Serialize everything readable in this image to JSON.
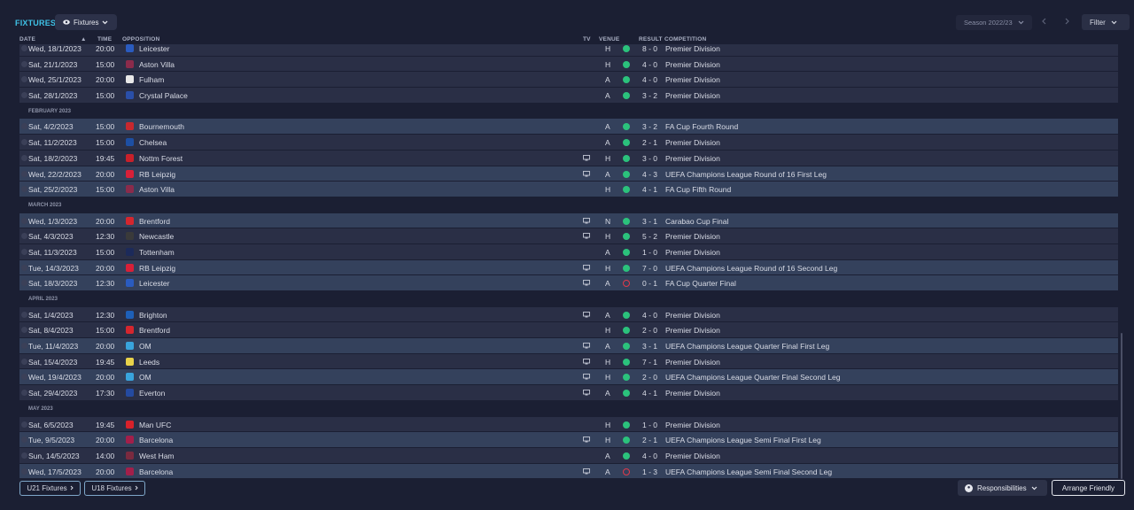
{
  "header": {
    "title": "FIXTURES",
    "view_label": "Fixtures",
    "season_label": "Season 2022/23",
    "filter_label": "Filter"
  },
  "columns": {
    "date": "DATE",
    "time": "TIME",
    "opposition": "OPPOSITION",
    "tv": "TV",
    "venue": "VENUE",
    "result": "RESULT",
    "competition": "COMPETITION"
  },
  "sections": [
    {
      "month": "",
      "rows": [
        {
          "date": "Wed, 18/1/2023",
          "time": "20:00",
          "opp": "Leicester",
          "crest": "#2a5bbf",
          "tv": false,
          "venue": "H",
          "outcome": "win",
          "result": "8 - 0",
          "comp": "Premier Division",
          "hl": false
        },
        {
          "date": "Sat, 21/1/2023",
          "time": "15:00",
          "opp": "Aston Villa",
          "crest": "#8b2b4b",
          "tv": false,
          "venue": "H",
          "outcome": "win",
          "result": "4 - 0",
          "comp": "Premier Division",
          "hl": false
        },
        {
          "date": "Wed, 25/1/2023",
          "time": "20:00",
          "opp": "Fulham",
          "crest": "#e8e8e8",
          "tv": false,
          "venue": "A",
          "outcome": "win",
          "result": "4 - 0",
          "comp": "Premier Division",
          "hl": false
        },
        {
          "date": "Sat, 28/1/2023",
          "time": "15:00",
          "opp": "Crystal Palace",
          "crest": "#2a4fa8",
          "tv": false,
          "venue": "A",
          "outcome": "win",
          "result": "3 - 2",
          "comp": "Premier Division",
          "hl": false
        }
      ]
    },
    {
      "month": "FEBRUARY 2023",
      "rows": [
        {
          "date": "Sat, 4/2/2023",
          "time": "15:00",
          "opp": "Bournemouth",
          "crest": "#c8282e",
          "tv": false,
          "venue": "A",
          "outcome": "win",
          "result": "3 - 2",
          "comp": "FA Cup Fourth Round",
          "hl": true
        },
        {
          "date": "Sat, 11/2/2023",
          "time": "15:00",
          "opp": "Chelsea",
          "crest": "#1d4fa3",
          "tv": false,
          "venue": "A",
          "outcome": "win",
          "result": "2 - 1",
          "comp": "Premier Division",
          "hl": false
        },
        {
          "date": "Sat, 18/2/2023",
          "time": "19:45",
          "opp": "Nottm Forest",
          "crest": "#c8202a",
          "tv": true,
          "venue": "H",
          "outcome": "win",
          "result": "3 - 0",
          "comp": "Premier Division",
          "hl": false
        },
        {
          "date": "Wed, 22/2/2023",
          "time": "20:00",
          "opp": "RB Leipzig",
          "crest": "#d82038",
          "tv": true,
          "venue": "A",
          "outcome": "win",
          "result": "4 - 3",
          "comp": "UEFA Champions League Round of 16  First Leg",
          "hl": true
        },
        {
          "date": "Sat, 25/2/2023",
          "time": "15:00",
          "opp": "Aston Villa",
          "crest": "#8b2b4b",
          "tv": false,
          "venue": "H",
          "outcome": "win",
          "result": "4 - 1",
          "comp": "FA Cup Fifth Round",
          "hl": true
        }
      ]
    },
    {
      "month": "MARCH 2023",
      "rows": [
        {
          "date": "Wed, 1/3/2023",
          "time": "20:00",
          "opp": "Brentford",
          "crest": "#d4262e",
          "tv": true,
          "venue": "N",
          "outcome": "win",
          "result": "3 - 1",
          "comp": "Carabao Cup Final",
          "hl": true
        },
        {
          "date": "Sat, 4/3/2023",
          "time": "12:30",
          "opp": "Newcastle",
          "crest": "#3a3a3a",
          "tv": true,
          "venue": "H",
          "outcome": "win",
          "result": "5 - 2",
          "comp": "Premier Division",
          "hl": false
        },
        {
          "date": "Sat, 11/3/2023",
          "time": "15:00",
          "opp": "Tottenham",
          "crest": "#1c2a5a",
          "tv": false,
          "venue": "A",
          "outcome": "win",
          "result": "1 - 0",
          "comp": "Premier Division",
          "hl": false
        },
        {
          "date": "Tue, 14/3/2023",
          "time": "20:00",
          "opp": "RB Leipzig",
          "crest": "#d82038",
          "tv": true,
          "venue": "H",
          "outcome": "win",
          "result": "7 - 0",
          "comp": "UEFA Champions League Round of 16  Second Leg",
          "hl": true
        },
        {
          "date": "Sat, 18/3/2023",
          "time": "12:30",
          "opp": "Leicester",
          "crest": "#2a5bbf",
          "tv": true,
          "venue": "A",
          "outcome": "loss",
          "result": "0 - 1",
          "comp": "FA Cup Quarter Final",
          "hl": true
        }
      ]
    },
    {
      "month": "APRIL 2023",
      "rows": [
        {
          "date": "Sat, 1/4/2023",
          "time": "12:30",
          "opp": "Brighton",
          "crest": "#1e60b8",
          "tv": true,
          "venue": "A",
          "outcome": "win",
          "result": "4 - 0",
          "comp": "Premier Division",
          "hl": false
        },
        {
          "date": "Sat, 8/4/2023",
          "time": "15:00",
          "opp": "Brentford",
          "crest": "#d4262e",
          "tv": false,
          "venue": "H",
          "outcome": "win",
          "result": "2 - 0",
          "comp": "Premier Division",
          "hl": false
        },
        {
          "date": "Tue, 11/4/2023",
          "time": "20:00",
          "opp": "OM",
          "crest": "#39a4dc",
          "tv": true,
          "venue": "A",
          "outcome": "win",
          "result": "3 - 1",
          "comp": "UEFA Champions League Quarter Final First Leg",
          "hl": true
        },
        {
          "date": "Sat, 15/4/2023",
          "time": "19:45",
          "opp": "Leeds",
          "crest": "#e8d24a",
          "tv": true,
          "venue": "H",
          "outcome": "win",
          "result": "7 - 1",
          "comp": "Premier Division",
          "hl": false
        },
        {
          "date": "Wed, 19/4/2023",
          "time": "20:00",
          "opp": "OM",
          "crest": "#39a4dc",
          "tv": true,
          "venue": "H",
          "outcome": "win",
          "result": "2 - 0",
          "comp": "UEFA Champions League Quarter Final Second Leg",
          "hl": true
        },
        {
          "date": "Sat, 29/4/2023",
          "time": "17:30",
          "opp": "Everton",
          "crest": "#244aa0",
          "tv": true,
          "venue": "A",
          "outcome": "win",
          "result": "4 - 1",
          "comp": "Premier Division",
          "hl": false
        }
      ]
    },
    {
      "month": "MAY 2023",
      "rows": [
        {
          "date": "Sat, 6/5/2023",
          "time": "19:45",
          "opp": "Man UFC",
          "crest": "#d8212a",
          "tv": false,
          "venue": "H",
          "outcome": "win",
          "result": "1 - 0",
          "comp": "Premier Division",
          "hl": false
        },
        {
          "date": "Tue, 9/5/2023",
          "time": "20:00",
          "opp": "Barcelona",
          "crest": "#a31f4a",
          "tv": true,
          "venue": "H",
          "outcome": "win",
          "result": "2 - 1",
          "comp": "UEFA Champions League Semi Final First Leg",
          "hl": true
        },
        {
          "date": "Sun, 14/5/2023",
          "time": "14:00",
          "opp": "West Ham",
          "crest": "#7a2a3f",
          "tv": false,
          "venue": "A",
          "outcome": "win",
          "result": "4 - 0",
          "comp": "Premier Division",
          "hl": false
        },
        {
          "date": "Wed, 17/5/2023",
          "time": "20:00",
          "opp": "Barcelona",
          "crest": "#a31f4a",
          "tv": true,
          "venue": "A",
          "outcome": "loss",
          "result": "1 - 3",
          "comp": "UEFA Champions League Semi Final Second Leg",
          "hl": true
        }
      ]
    }
  ],
  "footer": {
    "u21_label": "U21 Fixtures",
    "u18_label": "U18 Fixtures",
    "responsibilities_label": "Responsibilities",
    "arrange_label": "Arrange Friendly"
  }
}
